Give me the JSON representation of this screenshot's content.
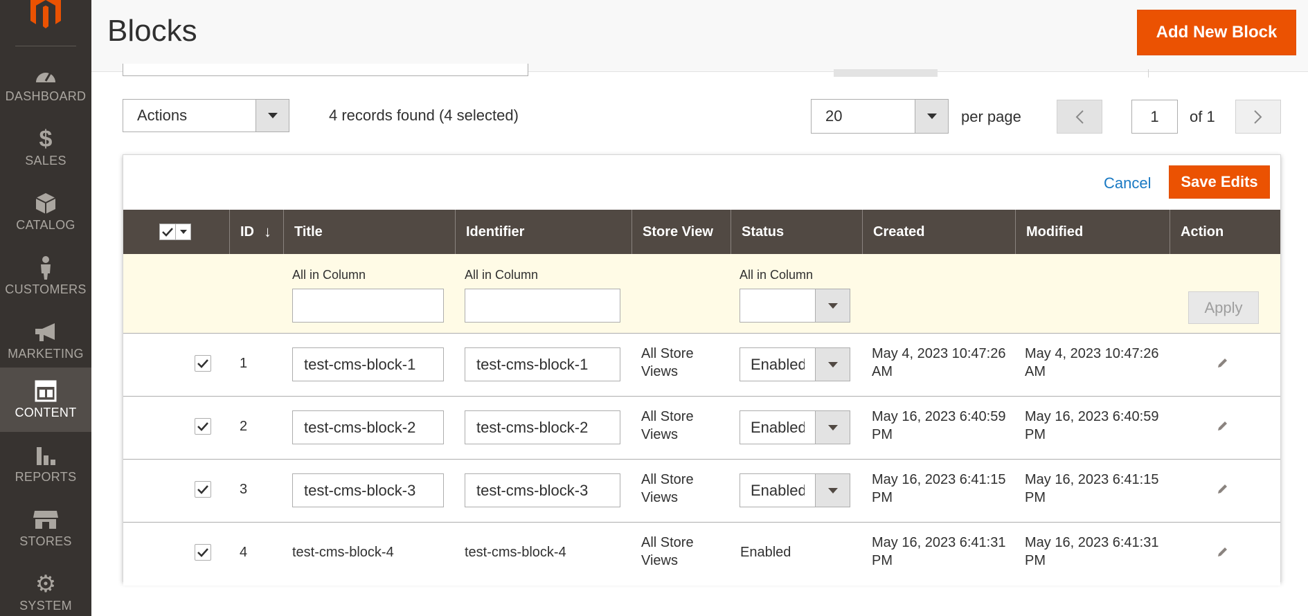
{
  "sidebar": {
    "items": [
      {
        "label": "DASHBOARD",
        "icon": "dashboard-icon"
      },
      {
        "label": "SALES",
        "icon": "dollar-icon"
      },
      {
        "label": "CATALOG",
        "icon": "cube-icon"
      },
      {
        "label": "CUSTOMERS",
        "icon": "person-icon"
      },
      {
        "label": "MARKETING",
        "icon": "megaphone-icon"
      },
      {
        "label": "CONTENT",
        "icon": "layout-icon",
        "active": true
      },
      {
        "label": "REPORTS",
        "icon": "bar-chart-icon"
      },
      {
        "label": "STORES",
        "icon": "storefront-icon"
      },
      {
        "label": "SYSTEM",
        "icon": "gear-icon"
      }
    ]
  },
  "header": {
    "title": "Blocks",
    "add_button": "Add New Block"
  },
  "toolbar": {
    "actions_label": "Actions",
    "records_text": "4 records found (4 selected)",
    "per_page_value": "20",
    "per_page_label": "per page",
    "page_value": "1",
    "page_of": "of 1"
  },
  "edit_bar": {
    "cancel": "Cancel",
    "save": "Save Edits"
  },
  "columns": [
    "ID",
    "Title",
    "Identifier",
    "Store View",
    "Status",
    "Created",
    "Modified",
    "Action"
  ],
  "bulk": {
    "all_in_column": "All in Column",
    "apply": "Apply"
  },
  "rows": [
    {
      "id": "1",
      "title": "test-cms-block-1",
      "identifier": "test-cms-block-1",
      "store_view_1": "All Store",
      "store_view_2": "Views",
      "status": "Enabled",
      "created_1": "May 4, 2023 10:47:26",
      "created_2": "AM",
      "modified_1": "May 4, 2023 10:47:26",
      "modified_2": "AM"
    },
    {
      "id": "2",
      "title": "test-cms-block-2",
      "identifier": "test-cms-block-2",
      "store_view_1": "All Store",
      "store_view_2": "Views",
      "status": "Enabled",
      "created_1": "May 16, 2023 6:40:59",
      "created_2": "PM",
      "modified_1": "May 16, 2023 6:40:59",
      "modified_2": "PM"
    },
    {
      "id": "3",
      "title": "test-cms-block-3",
      "identifier": "test-cms-block-3",
      "store_view_1": "All Store",
      "store_view_2": "Views",
      "status": "Enabled",
      "created_1": "May 16, 2023 6:41:15",
      "created_2": "PM",
      "modified_1": "May 16, 2023 6:41:15",
      "modified_2": "PM"
    },
    {
      "id": "4",
      "title": "test-cms-block-4",
      "identifier": "test-cms-block-4",
      "store_view_1": "All Store",
      "store_view_2": "Views",
      "status": "Enabled",
      "created_1": "May 16, 2023 6:41:31",
      "created_2": "PM",
      "modified_1": "May 16, 2023 6:41:31",
      "modified_2": "PM"
    }
  ],
  "colors": {
    "sidebar_bg": "#373330",
    "accent": "#eb5202",
    "grid_header": "#514943",
    "link": "#1979c3"
  }
}
